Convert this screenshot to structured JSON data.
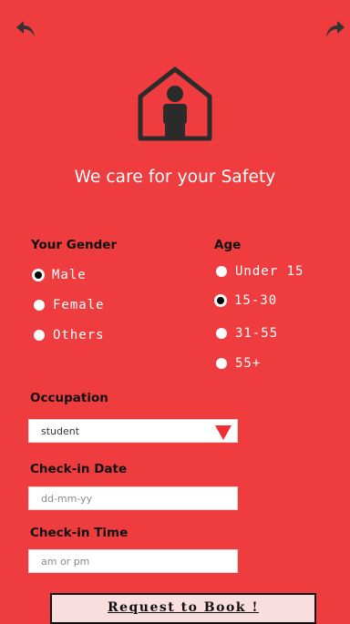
{
  "header": {
    "headline": "We care for your Safety"
  },
  "gender": {
    "label": "Your Gender",
    "options": [
      {
        "label": "Male",
        "checked": true
      },
      {
        "label": "Female",
        "checked": false
      },
      {
        "label": "Others",
        "checked": false
      }
    ]
  },
  "age": {
    "label": "Age",
    "options": [
      {
        "label": "Under 15",
        "checked": false
      },
      {
        "label": "15-30",
        "checked": true
      },
      {
        "label": "31-55",
        "checked": false
      },
      {
        "label": "55+",
        "checked": false
      }
    ]
  },
  "occupation": {
    "label": "Occupation",
    "selected": "student"
  },
  "checkin_date": {
    "label": "Check-in Date",
    "placeholder": "dd-mm-yy",
    "value": ""
  },
  "checkin_time": {
    "label": "Check-in Time",
    "placeholder": "am or pm",
    "value": ""
  },
  "request_button": {
    "label": "Request to Book !"
  },
  "colors": {
    "background": "#ee3c3f",
    "text_white": "#ffffff",
    "text_dark": "#111111",
    "select_arrow": "#ee2f33",
    "button_bg": "#f8dede"
  },
  "icons": {
    "back": "back-arrow-icon",
    "forward": "forward-arrow-icon",
    "home": "person-in-house-icon"
  }
}
